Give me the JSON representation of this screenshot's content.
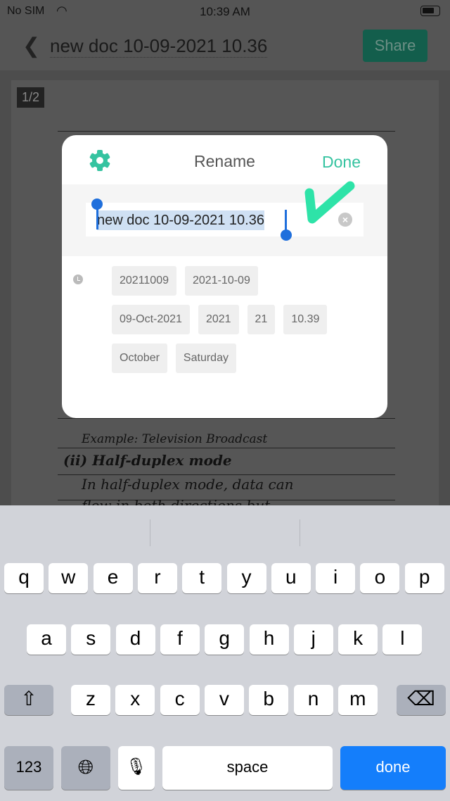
{
  "status": {
    "carrier": "No SIM",
    "time": "10:39 AM"
  },
  "nav": {
    "title": "new doc 10-09-2021 10.36",
    "share_label": "Share"
  },
  "document": {
    "page_indicator": "1/2",
    "lines": [
      "Example: Television Broadcast",
      "(ii) Half-duplex mode",
      "In half-duplex mode, data can",
      "flow in both directions but"
    ]
  },
  "dialog": {
    "title": "Rename",
    "done_label": "Done",
    "name_value": "new doc 10-09-2021 10.36",
    "chips": [
      [
        "20211009",
        "2021-10-09"
      ],
      [
        "09-Oct-2021",
        "2021",
        "21",
        "10.39"
      ],
      [
        "October",
        "Saturday"
      ]
    ]
  },
  "colors": {
    "accent": "#35c3a0",
    "selection": "#cfe0f3",
    "keyboard_done": "#147efb"
  },
  "keyboard": {
    "row1": [
      "q",
      "w",
      "e",
      "r",
      "t",
      "y",
      "u",
      "i",
      "o",
      "p"
    ],
    "row2": [
      "a",
      "s",
      "d",
      "f",
      "g",
      "h",
      "j",
      "k",
      "l"
    ],
    "row3": [
      "z",
      "x",
      "c",
      "v",
      "b",
      "n",
      "m"
    ],
    "numbers_label": "123",
    "space_label": "space",
    "done_label": "done"
  }
}
